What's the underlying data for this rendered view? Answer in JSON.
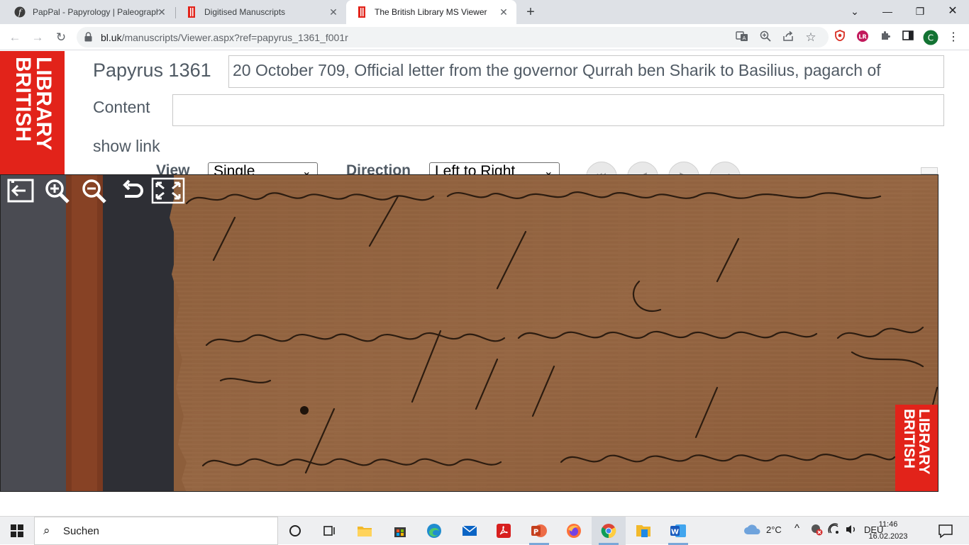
{
  "browser": {
    "tabs": [
      {
        "title": "PapPal - Papyrology | Paleograph",
        "favicon": "pappal-icon",
        "active": false
      },
      {
        "title": "Digitised Manuscripts",
        "favicon": "british-library-icon",
        "active": false
      },
      {
        "title": "The British Library MS Viewer",
        "favicon": "british-library-icon",
        "active": true
      }
    ],
    "new_tab_label": "+",
    "url_host": "bl.uk",
    "url_rest": "/manuscripts/Viewer.aspx?ref=papyrus_1361_f001r",
    "profile_initial": "C",
    "extension_initial": "LR"
  },
  "page": {
    "logo_text_line1": "LIBRARY",
    "logo_text_line2": "BRITISH",
    "ms_title": "Papyrus 1361",
    "ms_description": "20 October 709, Official letter from the governor Qurrah ben Sharik to Basilius, pagarch of",
    "content_label": "Content",
    "content_value": "",
    "show_link": "show link",
    "view_label": "View",
    "view_value": "Single",
    "direction_label": "Direction",
    "direction_value": "Left to Right"
  },
  "viewer": {
    "tools": [
      "exit-icon",
      "zoom-in-icon",
      "zoom-out-icon",
      "rotate-icon",
      "fullscreen-icon"
    ],
    "badge_line1": "LIBRARY",
    "badge_line2": "BRITISH"
  },
  "taskbar": {
    "search_label": "Suchen",
    "weather": "2°C",
    "language": "DEU",
    "time": "11:46",
    "date": "16.02.2023"
  },
  "colors": {
    "bl_red": "#e2231a",
    "papyrus": "#8d5e3b",
    "tab_strip": "#dee1e6",
    "text_grey": "#505a64"
  }
}
